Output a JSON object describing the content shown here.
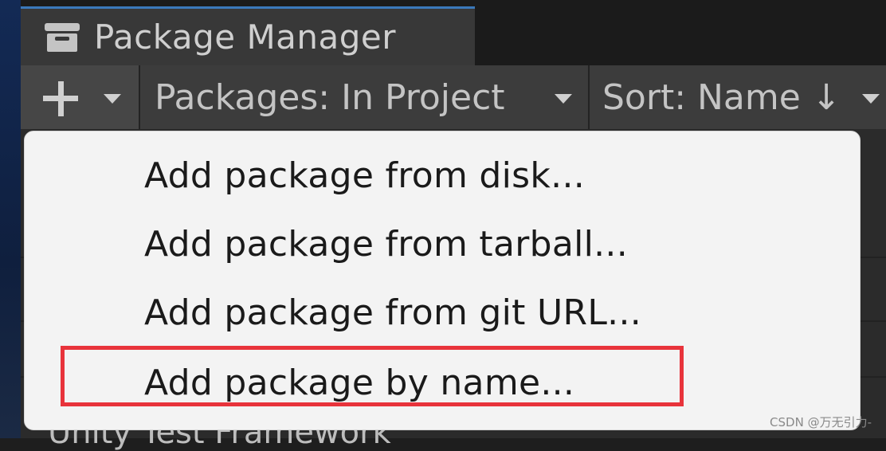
{
  "window": {
    "tab_title": "Package Manager",
    "tab_icon": "package-box-icon",
    "accent": "#3a79bb"
  },
  "toolbar": {
    "add_button_icon": "plus-icon",
    "filter_label": "Packages: In Project",
    "sort_label": "Sort: Name ↓"
  },
  "menu": {
    "items": [
      {
        "label": "Add package from disk..."
      },
      {
        "label": "Add package from tarball..."
      },
      {
        "label": "Add package from git URL..."
      },
      {
        "label": "Add package by name..."
      }
    ],
    "highlight_color": "#e8333b"
  },
  "background": {
    "partial_row_text": "Unity Test Framework"
  },
  "watermark": "CSDN @万无引力-"
}
